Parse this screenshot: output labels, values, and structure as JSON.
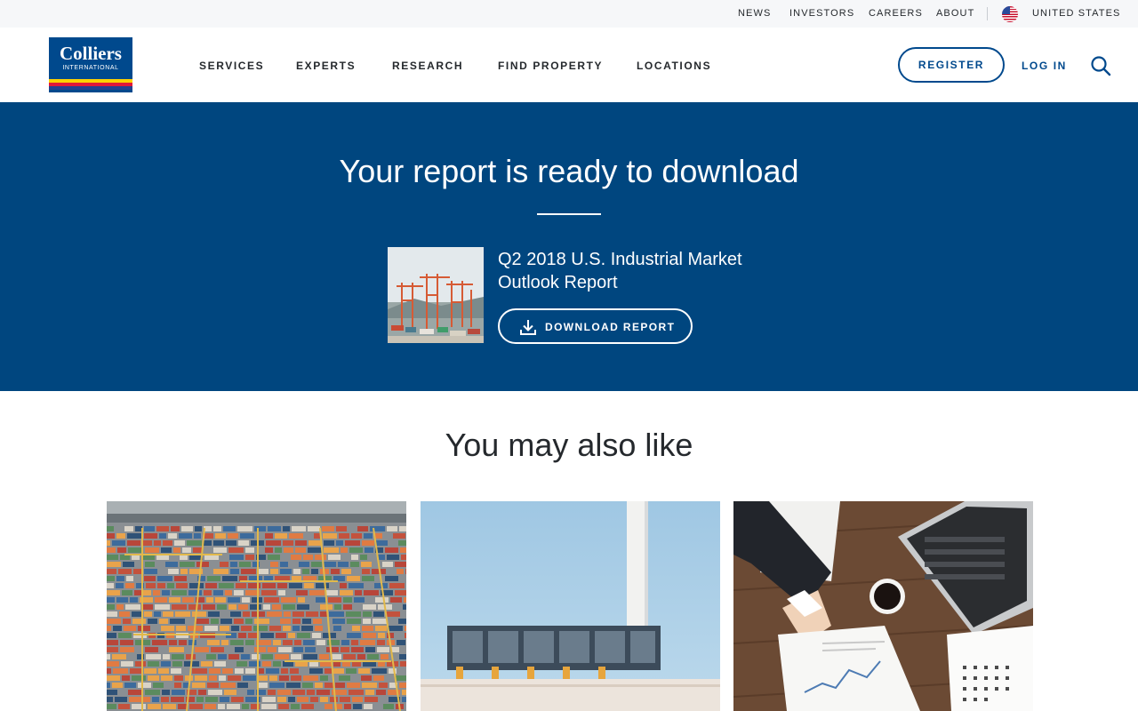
{
  "utility_nav": {
    "news": "NEWS",
    "investors": "INVESTORS",
    "careers": "CAREERS",
    "about": "ABOUT",
    "country": "UNITED STATES"
  },
  "header": {
    "logo_word": "Colliers",
    "logo_sub": "INTERNATIONAL",
    "nav": [
      "SERVICES",
      "EXPERTS",
      "RESEARCH",
      "FIND PROPERTY",
      "LOCATIONS"
    ],
    "register_label": "REGISTER",
    "login_label": "LOG IN"
  },
  "hero": {
    "title": "Your report is ready to download",
    "report_title": "Q2 2018 U.S. Industrial Market Outlook Report",
    "download_label": "DOWNLOAD REPORT"
  },
  "related": {
    "heading": "You may also like"
  },
  "colors": {
    "brand_blue": "#00467f",
    "logo_blue": "#00498d",
    "logo_yellow": "#ffd200",
    "logo_red": "#e31837",
    "text_dark": "#25292d"
  },
  "icons": {
    "search": "search-icon",
    "download": "download-icon",
    "flag": "us-flag-icon"
  }
}
